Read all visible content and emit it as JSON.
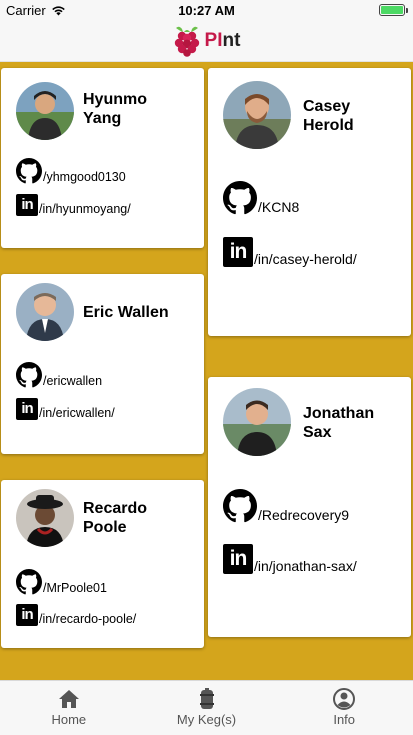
{
  "status": {
    "carrier": "Carrier",
    "time": "10:27 AM"
  },
  "header": {
    "brand_pi": "PI",
    "brand_nt": "nt"
  },
  "people": [
    {
      "first": "Hyunmo",
      "last": "Yang",
      "github": "/yhmgood0130",
      "linkedin": "/in/hyunmoyang/"
    },
    {
      "first": "Casey",
      "last": "Herold",
      "github": "/KCN8",
      "linkedin": "/in/casey-herold/"
    },
    {
      "first": "Eric Wallen",
      "last": "",
      "github": "/ericwallen",
      "linkedin": "/in/ericwallen/"
    },
    {
      "first": "Jonathan",
      "last": "Sax",
      "github": "/Redrecovery9",
      "linkedin": "/in/jonathan-sax/"
    },
    {
      "first": "Recardo",
      "last": "Poole",
      "github": "/MrPoole01",
      "linkedin": "/in/recardo-poole/"
    }
  ],
  "icons": {
    "github": "github-icon",
    "linkedin": "linkedin-icon",
    "linkedin_text": "in"
  },
  "tabs": [
    {
      "label": "Home",
      "icon": "home-icon"
    },
    {
      "label": "My Keg(s)",
      "icon": "keg-icon"
    },
    {
      "label": "Info",
      "icon": "user-icon"
    }
  ],
  "colors": {
    "background": "#d4a51c",
    "brand": "#c51a4a",
    "card": "#ffffff",
    "battery": "#4cd964"
  }
}
